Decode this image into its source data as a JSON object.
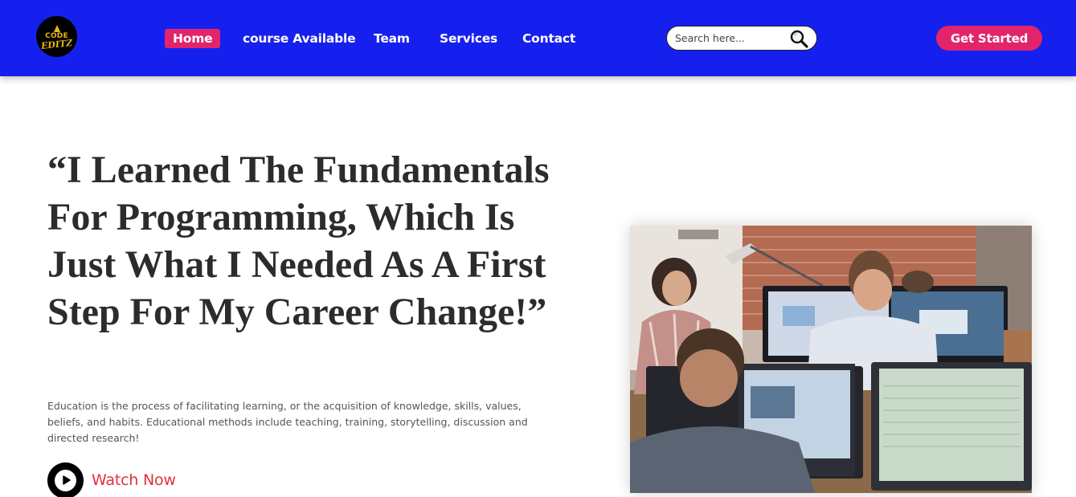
{
  "brand": {
    "logo_line1": "CODE",
    "logo_line2": "EDITZ"
  },
  "nav": {
    "items": [
      {
        "label": "Home",
        "active": true
      },
      {
        "label": "course Available",
        "active": false
      },
      {
        "label": "Team",
        "active": false
      },
      {
        "label": "Services",
        "active": false
      },
      {
        "label": "Contact",
        "active": false
      }
    ]
  },
  "search": {
    "placeholder": "Search here...",
    "value": "",
    "icon": "search-icon"
  },
  "cta": {
    "label": "Get Started"
  },
  "hero": {
    "quote": "“I Learned The Fundamentals For Programming, Which Is Just What I Needed As A First Step For My Career Change!”",
    "description": "Education is the process of facilitating learning, or the acquisition of knowledge, skills, values, beliefs, and habits. Educational methods include teaching, training, storytelling, discussion and directed research!",
    "watch_label": "Watch Now",
    "play_icon": "play-icon"
  },
  "colors": {
    "header_bg": "#1620ee",
    "accent": "#e2246a",
    "watch_text": "#e2303e",
    "heading_text": "#2c2c2c"
  }
}
